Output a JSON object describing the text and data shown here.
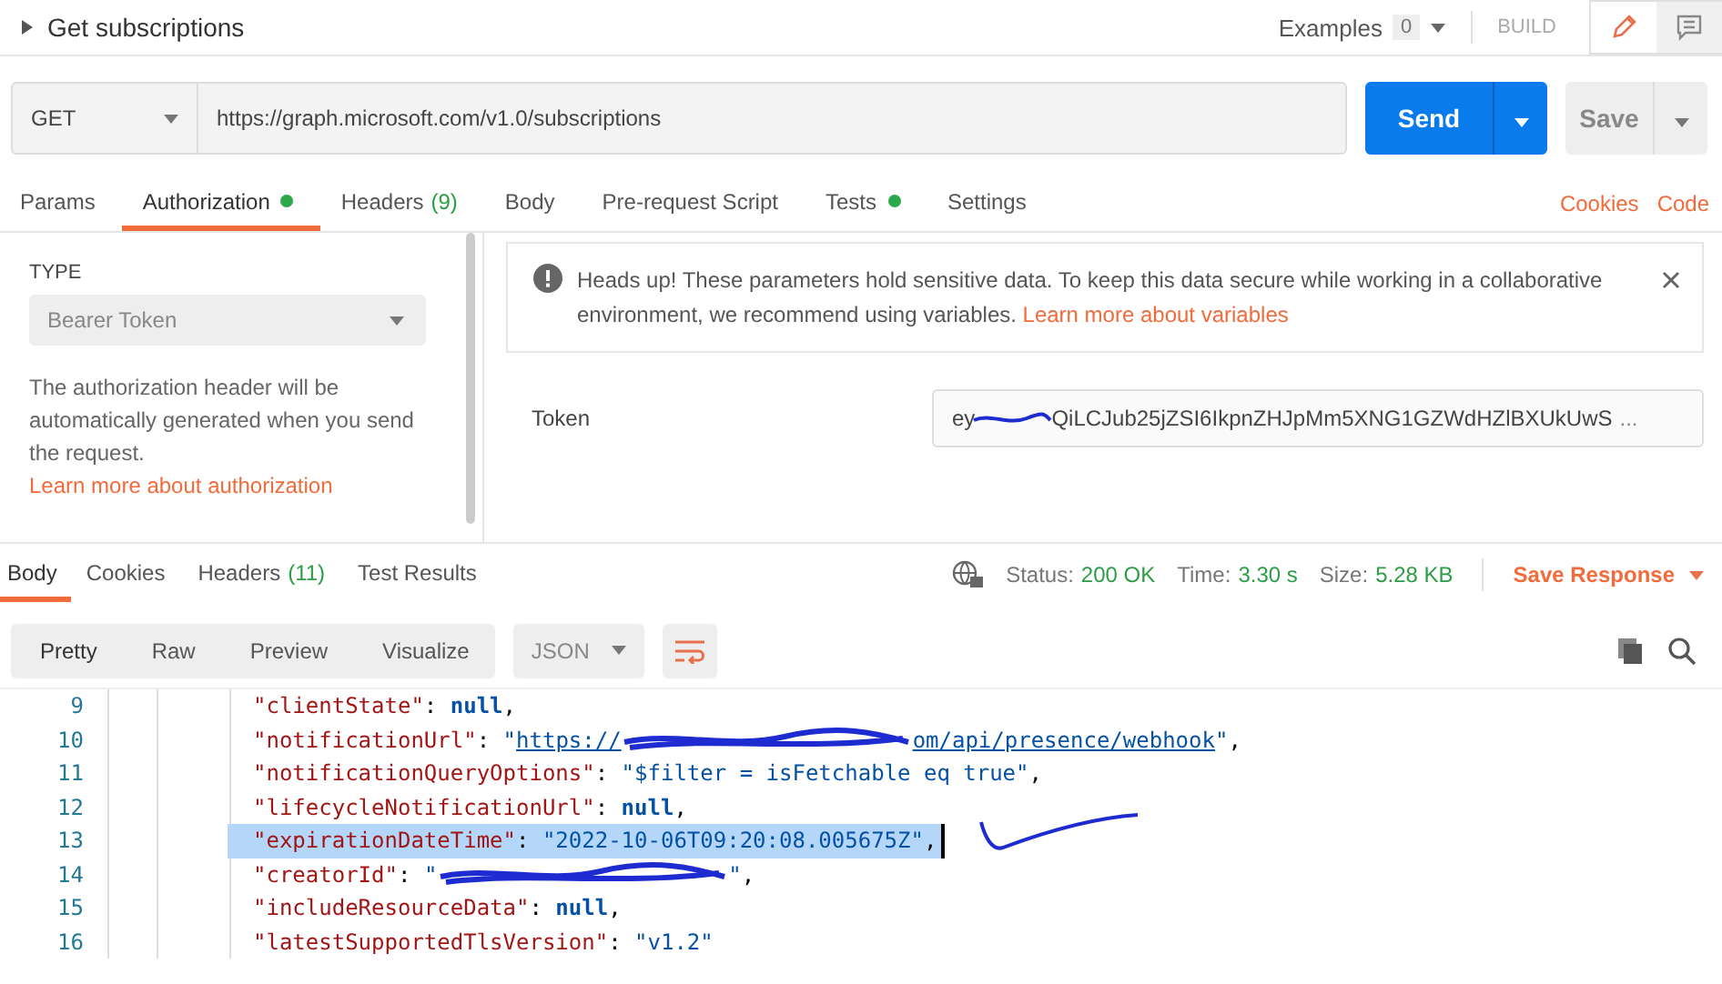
{
  "request": {
    "name": "Get subscriptions",
    "examples_label": "Examples",
    "examples_count": "0",
    "build_label": "BUILD"
  },
  "url_bar": {
    "method": "GET",
    "url": "https://graph.microsoft.com/v1.0/subscriptions",
    "send": "Send",
    "save": "Save"
  },
  "request_tabs": [
    {
      "label": "Params",
      "selected": false,
      "dot": false
    },
    {
      "label": "Authorization",
      "selected": true,
      "dot": true
    },
    {
      "label": "Headers",
      "count": "(9)",
      "selected": false,
      "dot": false
    },
    {
      "label": "Body",
      "selected": false,
      "dot": false
    },
    {
      "label": "Pre-request Script",
      "selected": false,
      "dot": false
    },
    {
      "label": "Tests",
      "selected": false,
      "dot": true
    },
    {
      "label": "Settings",
      "selected": false,
      "dot": false
    }
  ],
  "request_links": [
    "Cookies",
    "Code"
  ],
  "auth": {
    "type_label": "TYPE",
    "type_value": "Bearer Token",
    "description": "The authorization header will be automatically generated when you send the request.",
    "description_link": "Learn more about authorization",
    "notice": "Heads up! These parameters hold sensitive data. To keep this data secure while working in a collaborative environment, we recommend using variables.",
    "notice_link": "Learn more about variables",
    "token_label": "Token",
    "token_start": "ey",
    "token_rest": "QiLCJub25jZSI6IkpnZHJpMm5XNG1GZWdHZlBXUkUwS",
    "token_ellipsis": "..."
  },
  "response_tabs": [
    {
      "label": "Body",
      "selected": true
    },
    {
      "label": "Cookies",
      "selected": false
    },
    {
      "label": "Headers",
      "count": "(11)",
      "selected": false
    },
    {
      "label": "Test Results",
      "selected": false
    }
  ],
  "response_stats": [
    {
      "label": "Status:",
      "value": "200 OK"
    },
    {
      "label": "Time:",
      "value": "3.30 s"
    },
    {
      "label": "Size:",
      "value": "5.28 KB"
    }
  ],
  "save_response": "Save Response",
  "view_modes": [
    {
      "label": "Pretty",
      "selected": true
    },
    {
      "label": "Raw",
      "selected": false
    },
    {
      "label": "Preview",
      "selected": false
    },
    {
      "label": "Visualize",
      "selected": false
    }
  ],
  "format": "JSON",
  "code_lines": [
    {
      "number": "9",
      "selected": false,
      "parts": [
        {
          "kind": "key",
          "text": "\"clientState\""
        },
        {
          "kind": "punct",
          "text": ": "
        },
        {
          "kind": "null",
          "text": "null"
        },
        {
          "kind": "punct",
          "text": ","
        }
      ]
    },
    {
      "number": "10",
      "selected": false,
      "parts": [
        {
          "kind": "key",
          "text": "\"notificationUrl\""
        },
        {
          "kind": "punct",
          "text": ": "
        },
        {
          "kind": "string",
          "text": "\""
        },
        {
          "kind": "link",
          "text": "https://"
        },
        {
          "kind": "redacted"
        },
        {
          "kind": "link",
          "text": "om/api/presence/webhook"
        },
        {
          "kind": "string",
          "text": "\""
        },
        {
          "kind": "punct",
          "text": ","
        }
      ]
    },
    {
      "number": "11",
      "selected": false,
      "parts": [
        {
          "kind": "key",
          "text": "\"notificationQueryOptions\""
        },
        {
          "kind": "punct",
          "text": ": "
        },
        {
          "kind": "string",
          "text": "\"$filter = isFetchable eq true\""
        },
        {
          "kind": "punct",
          "text": ","
        }
      ]
    },
    {
      "number": "12",
      "selected": false,
      "parts": [
        {
          "kind": "key",
          "text": "\"lifecycleNotificationUrl\""
        },
        {
          "kind": "punct",
          "text": ": "
        },
        {
          "kind": "null",
          "text": "null"
        },
        {
          "kind": "punct",
          "text": ","
        }
      ]
    },
    {
      "number": "13",
      "selected": true,
      "parts": [
        {
          "kind": "key",
          "text": "\"expirationDateTime\""
        },
        {
          "kind": "punct",
          "text": ": "
        },
        {
          "kind": "string",
          "text": "\"2022-10-06T09:20:08.005675Z\""
        },
        {
          "kind": "punct",
          "text": ","
        }
      ]
    },
    {
      "number": "14",
      "selected": false,
      "parts": [
        {
          "kind": "key",
          "text": "\"creatorId\""
        },
        {
          "kind": "punct",
          "text": ": "
        },
        {
          "kind": "string",
          "text": "\""
        },
        {
          "kind": "redacted"
        },
        {
          "kind": "string",
          "text": "\""
        },
        {
          "kind": "punct",
          "text": ","
        }
      ]
    },
    {
      "number": "15",
      "selected": false,
      "parts": [
        {
          "kind": "key",
          "text": "\"includeResourceData\""
        },
        {
          "kind": "punct",
          "text": ": "
        },
        {
          "kind": "null",
          "text": "null"
        },
        {
          "kind": "punct",
          "text": ","
        }
      ]
    },
    {
      "number": "16",
      "selected": false,
      "parts": [
        {
          "kind": "key",
          "text": "\"latestSupportedTlsVersion\""
        },
        {
          "kind": "punct",
          "text": ": "
        },
        {
          "kind": "string",
          "text": "\"v1.2\""
        }
      ]
    }
  ]
}
